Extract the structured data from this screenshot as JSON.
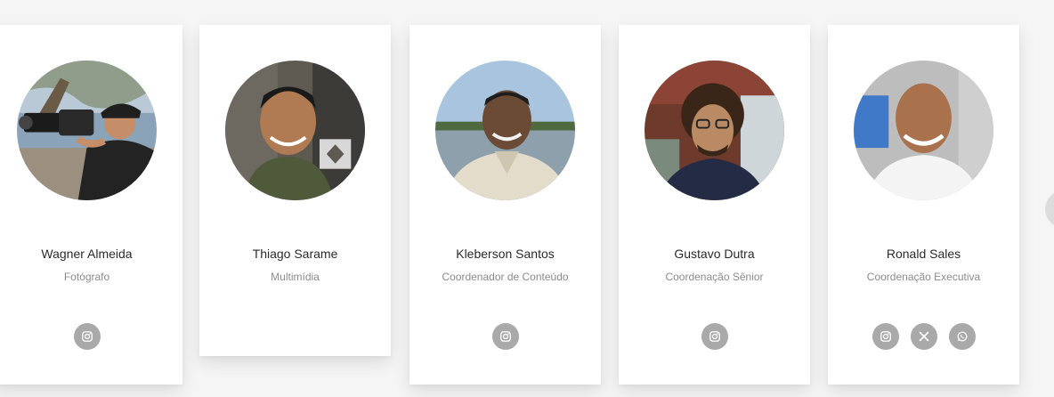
{
  "team": {
    "members": [
      {
        "name": "Wagner Almeida",
        "role": "Fotógrafo",
        "photo": "photographer-with-camera",
        "socials": [
          "instagram-icon"
        ]
      },
      {
        "name": "Thiago Sarame",
        "role": "Multimídia",
        "photo": "man-smiling-by-truck",
        "socials": []
      },
      {
        "name": "Kleberson Santos",
        "role": "Coordenador de Conteúdo",
        "photo": "man-by-river",
        "socials": [
          "instagram-icon"
        ]
      },
      {
        "name": "Gustavo Dutra",
        "role": "Coordenação Sênior",
        "photo": "man-curly-hair-glasses",
        "socials": [
          "instagram-icon"
        ]
      },
      {
        "name": "Ronald Sales",
        "role": "Coordenação Executiva",
        "photo": "man-smiling-white-shirt",
        "socials": [
          "instagram-icon",
          "x-icon",
          "whatsapp-icon"
        ]
      }
    ]
  },
  "colors": {
    "card_bg": "#ffffff",
    "page_bg": "#f5f5f5",
    "name_text": "#2b2b2b",
    "role_text": "#8c8c8c",
    "social_bg": "#a9a9a9"
  },
  "carousel": {
    "next_button_icon": "chevron-right-icon"
  }
}
